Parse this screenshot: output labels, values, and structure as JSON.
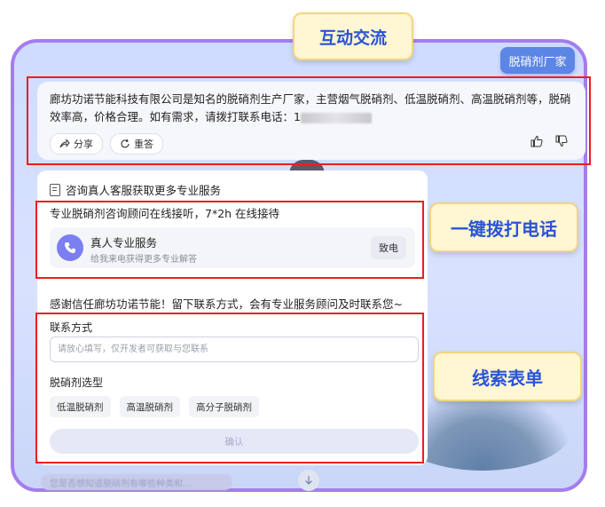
{
  "header": {
    "vendor_button": "脱硝剂厂家"
  },
  "message": {
    "text": "廊坊功诺节能科技有限公司是知名的脱硝剂生产厂家，主营烟气脱硝剂、低温脱硝剂、高温脱硝剂等，脱硝效率高，价格合理。如有需求，请拨打联系电话：1",
    "share_label": "分享",
    "retry_label": "重答"
  },
  "panel": {
    "title": "咨询真人客服获取更多专业服务",
    "consult_line": "专业脱硝剂咨询顾问在线接听，7*2h 在线接待",
    "service": {
      "title": "真人专业服务",
      "subtitle": "给我来电获得更多专业解答",
      "call_label": "致电"
    },
    "thanks": "感谢信任廊坊功诺节能！留下联系方式，会有专业服务顾问及时联系您~",
    "contact_label": "联系方式",
    "contact_placeholder": "请放心填写，仅开发者可获取与您联系",
    "type_label": "脱硝剂选型",
    "options": [
      "低温脱硝剂",
      "高温脱硝剂",
      "高分子脱硝剂"
    ],
    "confirm_label": "确认"
  },
  "bottom_hint": "您是否想知道脱硝剂有哪些种类和...",
  "callouts": {
    "interaction": "互动交流",
    "one_click_call": "一键拨打电话",
    "lead_form": "线索表单"
  },
  "colors": {
    "frame": "#a57cf0",
    "highlight_red": "#e8201e",
    "callout_text": "#2a54d6",
    "callout_bg": "#fff6d3",
    "vendor_button": "#5b86e5"
  }
}
